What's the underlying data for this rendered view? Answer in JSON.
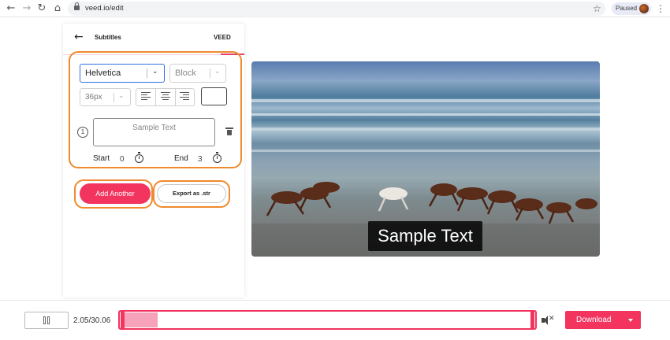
{
  "browser": {
    "url": "veed.io/edit",
    "profile_status": "Paused",
    "icons": [
      "back-arrow-icon",
      "forward-arrow-icon",
      "reload-icon",
      "home-icon",
      "lock-icon",
      "star-icon",
      "menu-kebab-icon"
    ]
  },
  "panel": {
    "title": "Subtitles",
    "brand": "VEED",
    "font": {
      "selected": "Helvetica"
    },
    "style": {
      "selected": "Block"
    },
    "size": {
      "selected": "36px"
    },
    "subtitle": {
      "index": "1",
      "text": "Sample Text",
      "start_label": "Start",
      "start_value": "0",
      "end_label": "End",
      "end_value": "3"
    },
    "add_button": "Add Another",
    "export_button": "Export as .str"
  },
  "video": {
    "caption": "Sample Text"
  },
  "timeline": {
    "time": "2.05/30.06",
    "progress": 0.068,
    "download_label": "Download"
  },
  "colors": {
    "accent": "#f2345f",
    "highlight": "#ef8a2d",
    "select_focus": "#2f6fe0"
  }
}
